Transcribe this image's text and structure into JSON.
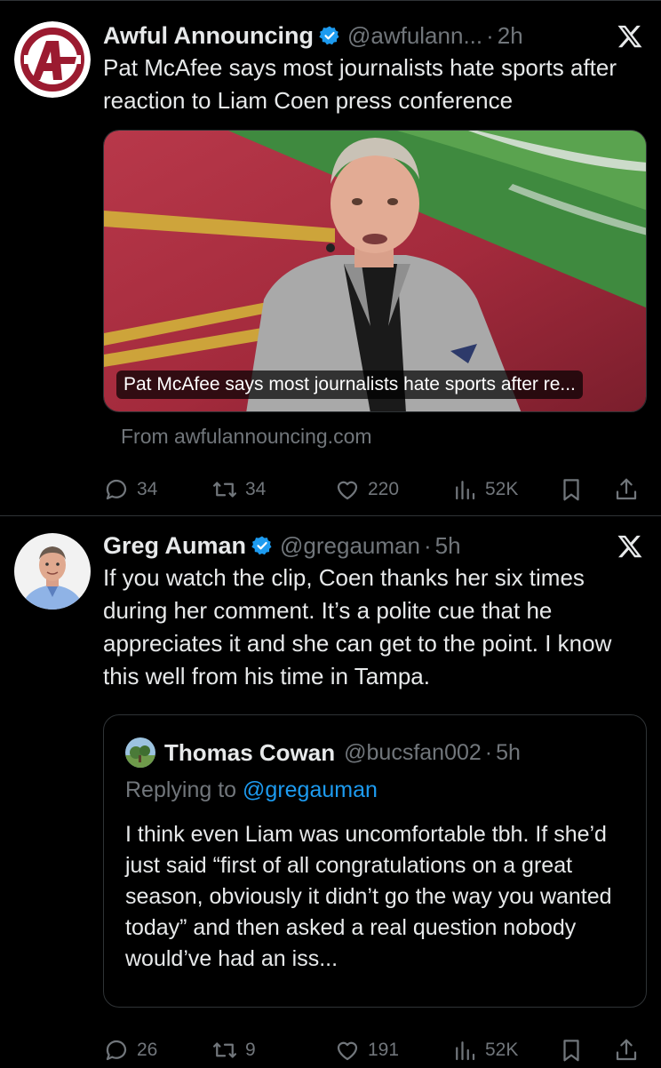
{
  "tweets": [
    {
      "name": "Awful Announcing",
      "handle": "@awfulann...",
      "dot": "·",
      "time": "2h",
      "text": "Pat McAfee says most journalists hate sports after reaction to Liam Coen press conference",
      "card": {
        "caption": "Pat McAfee says most journalists hate sports after re...",
        "source": "From awfulannouncing.com"
      },
      "actions": {
        "replies": "34",
        "reposts": "34",
        "likes": "220",
        "views": "52K"
      }
    },
    {
      "name": "Greg Auman",
      "handle": "@gregauman",
      "dot": "·",
      "time": "5h",
      "text": "If you watch the clip, Coen thanks her six times during her comment. It’s a polite cue that he appreciates it and she can get to the point. I know this well from his time in Tampa.",
      "quote": {
        "name": "Thomas Cowan",
        "handle": "@bucsfan002",
        "dot": "·",
        "time": "5h",
        "replying_prefix": "Replying to ",
        "replying_handle": "@gregauman",
        "text": "I think even Liam was uncomfortable tbh. If she’d just said “first of all congratulations on a great season, obviously it didn’t go the way you wanted today” and then asked a real question nobody would’ve had an iss..."
      },
      "actions": {
        "replies": "26",
        "reposts": "9",
        "likes": "191",
        "views": "52K"
      }
    }
  ],
  "colors": {
    "background": "#000000",
    "text": "#e7e9ea",
    "secondary": "#71767b",
    "link": "#1d9bf0",
    "verified": "#1d9bf0",
    "divider": "#2f3336"
  },
  "icons": [
    "x-logo-icon",
    "verified-badge-icon",
    "reply-icon",
    "repost-icon",
    "like-icon",
    "views-icon",
    "bookmark-icon",
    "share-icon"
  ]
}
